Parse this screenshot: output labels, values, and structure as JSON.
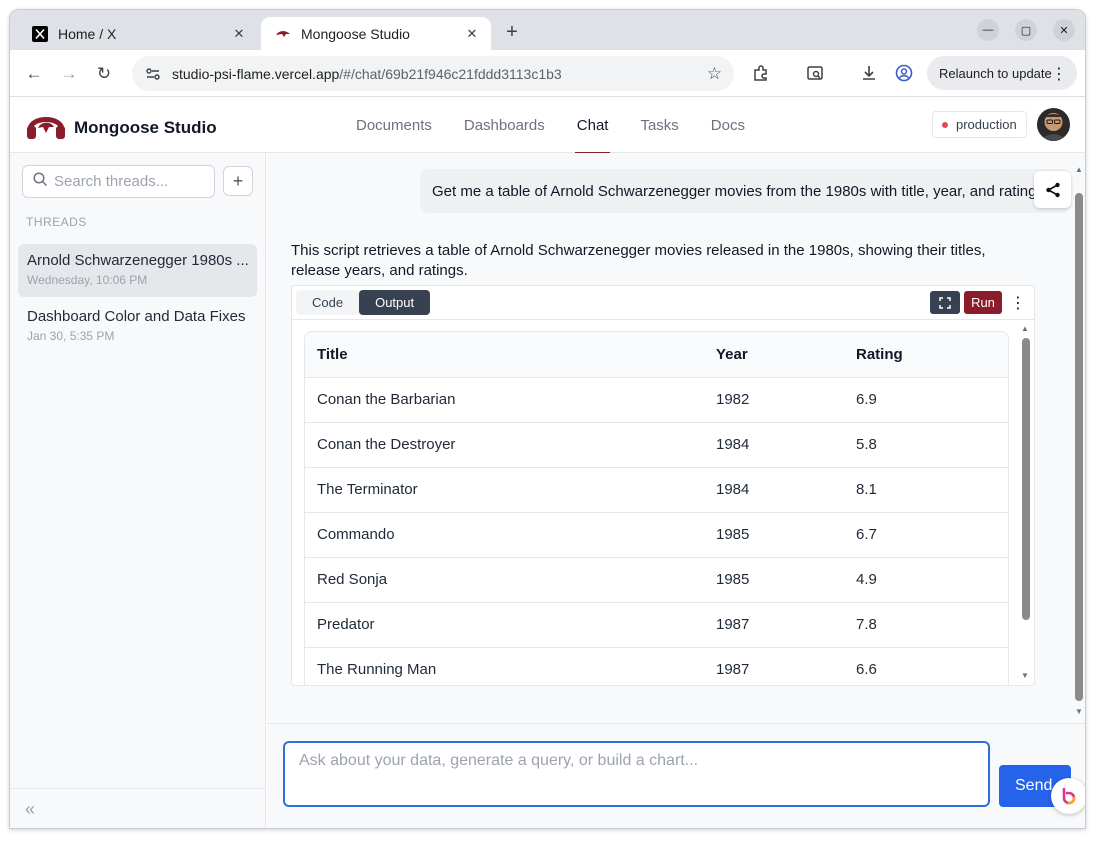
{
  "browser": {
    "tabs": [
      {
        "title": "Home / X",
        "favicon": "x-logo-icon",
        "active": false
      },
      {
        "title": "Mongoose Studio",
        "favicon": "mongoose-logo-icon",
        "active": true
      }
    ],
    "url_host": "studio-psi-flame.vercel.app",
    "url_path": "/#/chat/69b21f946c21fddd3113c1b3",
    "relaunch_label": "Relaunch to update"
  },
  "app": {
    "brand_name": "Mongoose Studio",
    "brand_color": "#8b1c2c",
    "nav": [
      {
        "label": "Documents",
        "active": false
      },
      {
        "label": "Dashboards",
        "active": false
      },
      {
        "label": "Chat",
        "active": true
      },
      {
        "label": "Tasks",
        "active": false
      },
      {
        "label": "Docs",
        "active": false
      }
    ],
    "environment": "production"
  },
  "sidebar": {
    "search_placeholder": "Search threads...",
    "threads_heading": "THREADS",
    "threads": [
      {
        "title": "Arnold Schwarzenegger 1980s ...",
        "date": "Wednesday, 10:06 PM",
        "selected": true
      },
      {
        "title": "Dashboard Color and Data Fixes",
        "date": "Jan 30, 5:35 PM",
        "selected": false
      }
    ]
  },
  "chat": {
    "user_message": "Get me a table of Arnold Schwarzenegger movies from the 1980s with title, year, and rating",
    "assistant_text": "This script retrieves a table of Arnold Schwarzenegger movies released in the 1980s, showing their titles, release years, and ratings.",
    "script": {
      "tabs": [
        {
          "label": "Code",
          "active": false
        },
        {
          "label": "Output",
          "active": true
        }
      ],
      "run_label": "Run",
      "table": {
        "headers": [
          "Title",
          "Year",
          "Rating"
        ],
        "rows": [
          [
            "Conan the Barbarian",
            "1982",
            "6.9"
          ],
          [
            "Conan the Destroyer",
            "1984",
            "5.8"
          ],
          [
            "The Terminator",
            "1984",
            "8.1"
          ],
          [
            "Commando",
            "1985",
            "6.7"
          ],
          [
            "Red Sonja",
            "1985",
            "4.9"
          ],
          [
            "Predator",
            "1987",
            "7.8"
          ],
          [
            "The Running Man",
            "1987",
            "6.6"
          ]
        ]
      }
    },
    "composer_placeholder": "Ask about your data, generate a query, or build a chart...",
    "send_label": "Send"
  }
}
